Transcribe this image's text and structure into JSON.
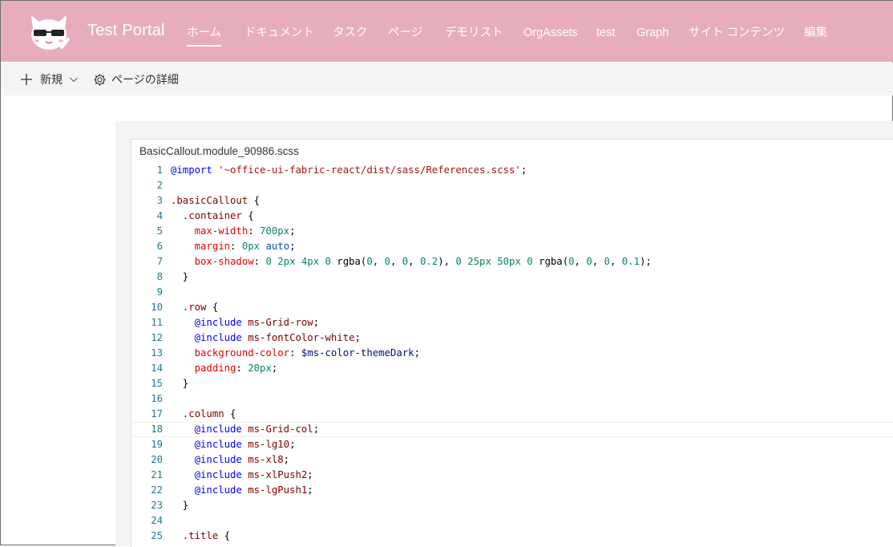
{
  "header": {
    "site_title": "Test Portal",
    "nav": [
      {
        "label": "ホーム",
        "active": true
      },
      {
        "label": "ドキュメント"
      },
      {
        "label": "タスク"
      },
      {
        "label": "ページ"
      },
      {
        "label": "デモリスト"
      },
      {
        "label": "OrgAssets"
      },
      {
        "label": "test"
      },
      {
        "label": "Graph"
      },
      {
        "label": "サイト コンテンツ"
      },
      {
        "label": "編集"
      }
    ],
    "logo_icon": "cat-with-sunglasses-logo"
  },
  "command_bar": {
    "new_label": "新規",
    "page_details_label": "ページの詳細"
  },
  "editor": {
    "filename": "BasicCallout.module_90986.scss",
    "current_line": 18,
    "lines": [
      {
        "n": "1",
        "tokens": [
          {
            "c": "at",
            "t": "@import"
          },
          {
            "c": "plain",
            "t": " "
          },
          {
            "c": "str",
            "t": "'~office-ui-fabric-react/dist/sass/References.scss'"
          },
          {
            "c": "plain",
            "t": ";"
          }
        ]
      },
      {
        "n": "2",
        "tokens": []
      },
      {
        "n": "3",
        "tokens": [
          {
            "c": "sel",
            "t": ".basicCallout"
          },
          {
            "c": "plain",
            "t": " {"
          }
        ]
      },
      {
        "n": "4",
        "tokens": [
          {
            "c": "sel",
            "t": "  .container"
          },
          {
            "c": "plain",
            "t": " {"
          }
        ]
      },
      {
        "n": "5",
        "tokens": [
          {
            "c": "prop",
            "t": "    max-width"
          },
          {
            "c": "plain",
            "t": ": "
          },
          {
            "c": "num",
            "t": "700px"
          },
          {
            "c": "plain",
            "t": ";"
          }
        ]
      },
      {
        "n": "6",
        "tokens": [
          {
            "c": "prop",
            "t": "    margin"
          },
          {
            "c": "plain",
            "t": ": "
          },
          {
            "c": "num",
            "t": "0px"
          },
          {
            "c": "plain",
            "t": " "
          },
          {
            "c": "kw",
            "t": "auto"
          },
          {
            "c": "plain",
            "t": ";"
          }
        ]
      },
      {
        "n": "7",
        "tokens": [
          {
            "c": "prop",
            "t": "    box-shadow"
          },
          {
            "c": "plain",
            "t": ": "
          },
          {
            "c": "num",
            "t": "0 2px 4px 0"
          },
          {
            "c": "plain",
            "t": " rgba("
          },
          {
            "c": "num",
            "t": "0"
          },
          {
            "c": "plain",
            "t": ", "
          },
          {
            "c": "num",
            "t": "0"
          },
          {
            "c": "plain",
            "t": ", "
          },
          {
            "c": "num",
            "t": "0"
          },
          {
            "c": "plain",
            "t": ", "
          },
          {
            "c": "num",
            "t": "0.2"
          },
          {
            "c": "plain",
            "t": "), "
          },
          {
            "c": "num",
            "t": "0 25px 50px 0"
          },
          {
            "c": "plain",
            "t": " rgba("
          },
          {
            "c": "num",
            "t": "0"
          },
          {
            "c": "plain",
            "t": ", "
          },
          {
            "c": "num",
            "t": "0"
          },
          {
            "c": "plain",
            "t": ", "
          },
          {
            "c": "num",
            "t": "0"
          },
          {
            "c": "plain",
            "t": ", "
          },
          {
            "c": "num",
            "t": "0.1"
          },
          {
            "c": "plain",
            "t": ");"
          }
        ]
      },
      {
        "n": "8",
        "tokens": [
          {
            "c": "plain",
            "t": "  }"
          }
        ]
      },
      {
        "n": "9",
        "tokens": []
      },
      {
        "n": "10",
        "tokens": [
          {
            "c": "sel",
            "t": "  .row"
          },
          {
            "c": "plain",
            "t": " {"
          }
        ]
      },
      {
        "n": "11",
        "tokens": [
          {
            "c": "at",
            "t": "    @include"
          },
          {
            "c": "plain",
            "t": " "
          },
          {
            "c": "sel",
            "t": "ms-Grid-row"
          },
          {
            "c": "plain",
            "t": ";"
          }
        ]
      },
      {
        "n": "12",
        "tokens": [
          {
            "c": "at",
            "t": "    @include"
          },
          {
            "c": "plain",
            "t": " "
          },
          {
            "c": "sel",
            "t": "ms-fontColor-white"
          },
          {
            "c": "plain",
            "t": ";"
          }
        ]
      },
      {
        "n": "13",
        "tokens": [
          {
            "c": "prop",
            "t": "    background-color"
          },
          {
            "c": "plain",
            "t": ": "
          },
          {
            "c": "var",
            "t": "$ms-color-themeDark"
          },
          {
            "c": "plain",
            "t": ";"
          }
        ]
      },
      {
        "n": "14",
        "tokens": [
          {
            "c": "prop",
            "t": "    padding"
          },
          {
            "c": "plain",
            "t": ": "
          },
          {
            "c": "num",
            "t": "20px"
          },
          {
            "c": "plain",
            "t": ";"
          }
        ]
      },
      {
        "n": "15",
        "tokens": [
          {
            "c": "plain",
            "t": "  }"
          }
        ]
      },
      {
        "n": "16",
        "tokens": []
      },
      {
        "n": "17",
        "tokens": [
          {
            "c": "sel",
            "t": "  .column"
          },
          {
            "c": "plain",
            "t": " {"
          }
        ]
      },
      {
        "n": "18",
        "tokens": [
          {
            "c": "at",
            "t": "    @include"
          },
          {
            "c": "plain",
            "t": " "
          },
          {
            "c": "sel",
            "t": "ms-Grid-col"
          },
          {
            "c": "plain",
            "t": ";"
          }
        ]
      },
      {
        "n": "19",
        "tokens": [
          {
            "c": "at",
            "t": "    @include"
          },
          {
            "c": "plain",
            "t": " "
          },
          {
            "c": "sel",
            "t": "ms-lg10"
          },
          {
            "c": "plain",
            "t": ";"
          }
        ]
      },
      {
        "n": "20",
        "tokens": [
          {
            "c": "at",
            "t": "    @include"
          },
          {
            "c": "plain",
            "t": " "
          },
          {
            "c": "sel",
            "t": "ms-xl8"
          },
          {
            "c": "plain",
            "t": ";"
          }
        ]
      },
      {
        "n": "21",
        "tokens": [
          {
            "c": "at",
            "t": "    @include"
          },
          {
            "c": "plain",
            "t": " "
          },
          {
            "c": "sel",
            "t": "ms-xlPush2"
          },
          {
            "c": "plain",
            "t": ";"
          }
        ]
      },
      {
        "n": "22",
        "tokens": [
          {
            "c": "at",
            "t": "    @include"
          },
          {
            "c": "plain",
            "t": " "
          },
          {
            "c": "sel",
            "t": "ms-lgPush1"
          },
          {
            "c": "plain",
            "t": ";"
          }
        ]
      },
      {
        "n": "23",
        "tokens": [
          {
            "c": "plain",
            "t": "  }"
          }
        ]
      },
      {
        "n": "24",
        "tokens": []
      },
      {
        "n": "25",
        "tokens": [
          {
            "c": "sel",
            "t": "  .title"
          },
          {
            "c": "plain",
            "t": " {"
          }
        ]
      }
    ]
  },
  "colors": {
    "header_bg": "#e8adbc",
    "command_bar_bg": "#f4f4f4",
    "line_number": "#237893"
  }
}
